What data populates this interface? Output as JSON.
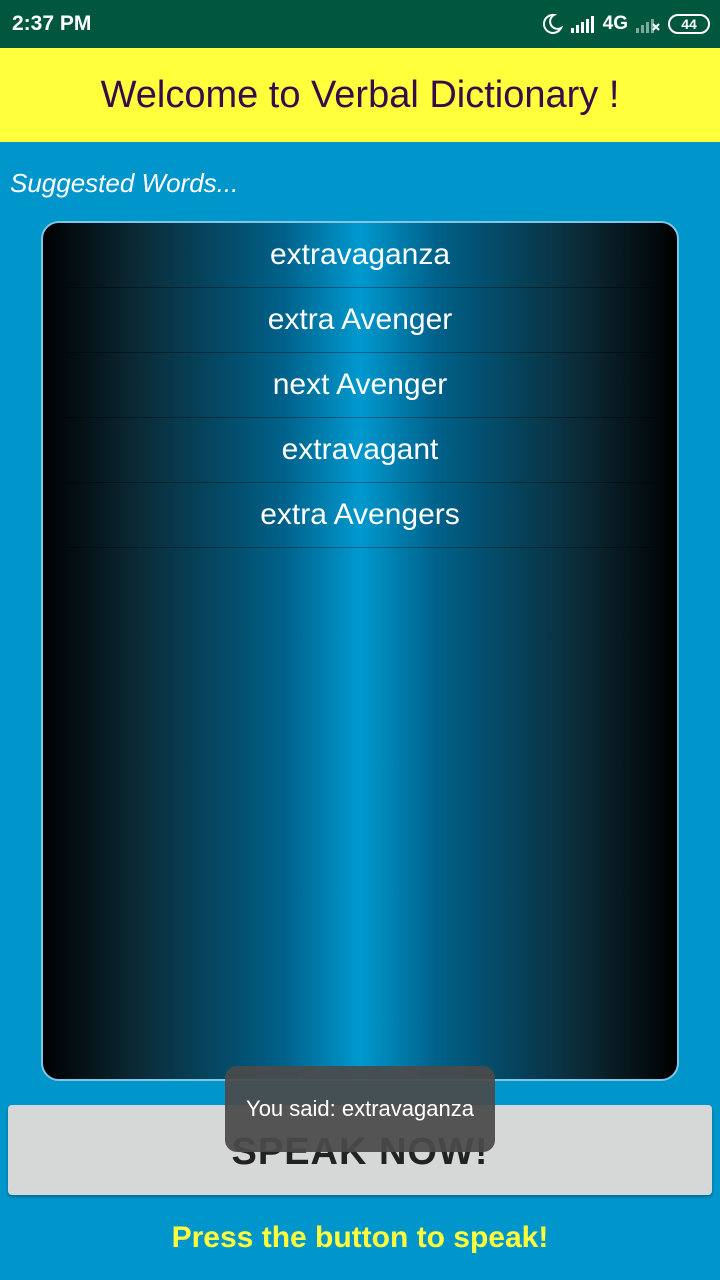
{
  "status_bar": {
    "time": "2:37 PM",
    "network_type": "4G",
    "battery_level": "44",
    "icons": [
      "moon-icon",
      "signal-icon",
      "signal-empty-icon",
      "battery-icon"
    ]
  },
  "app": {
    "title": "Welcome to Verbal Dictionary !",
    "suggested_label": "Suggested Words...",
    "words": [
      {
        "text": "extravaganza"
      },
      {
        "text": "extra Avenger"
      },
      {
        "text": "next Avenger"
      },
      {
        "text": "extravagant"
      },
      {
        "text": "extra Avengers"
      }
    ],
    "speak_button_label": "SPEAK NOW!",
    "hint": "Press the button to speak!"
  },
  "toast": {
    "message": "You said: extravaganza"
  },
  "colors": {
    "status_bar": "#00573d",
    "title_bar": "#ffff3c",
    "title_text": "#3a0b4a",
    "background": "#0096cc",
    "button": "#d6d7d7",
    "hint_text": "#ffff3c"
  }
}
